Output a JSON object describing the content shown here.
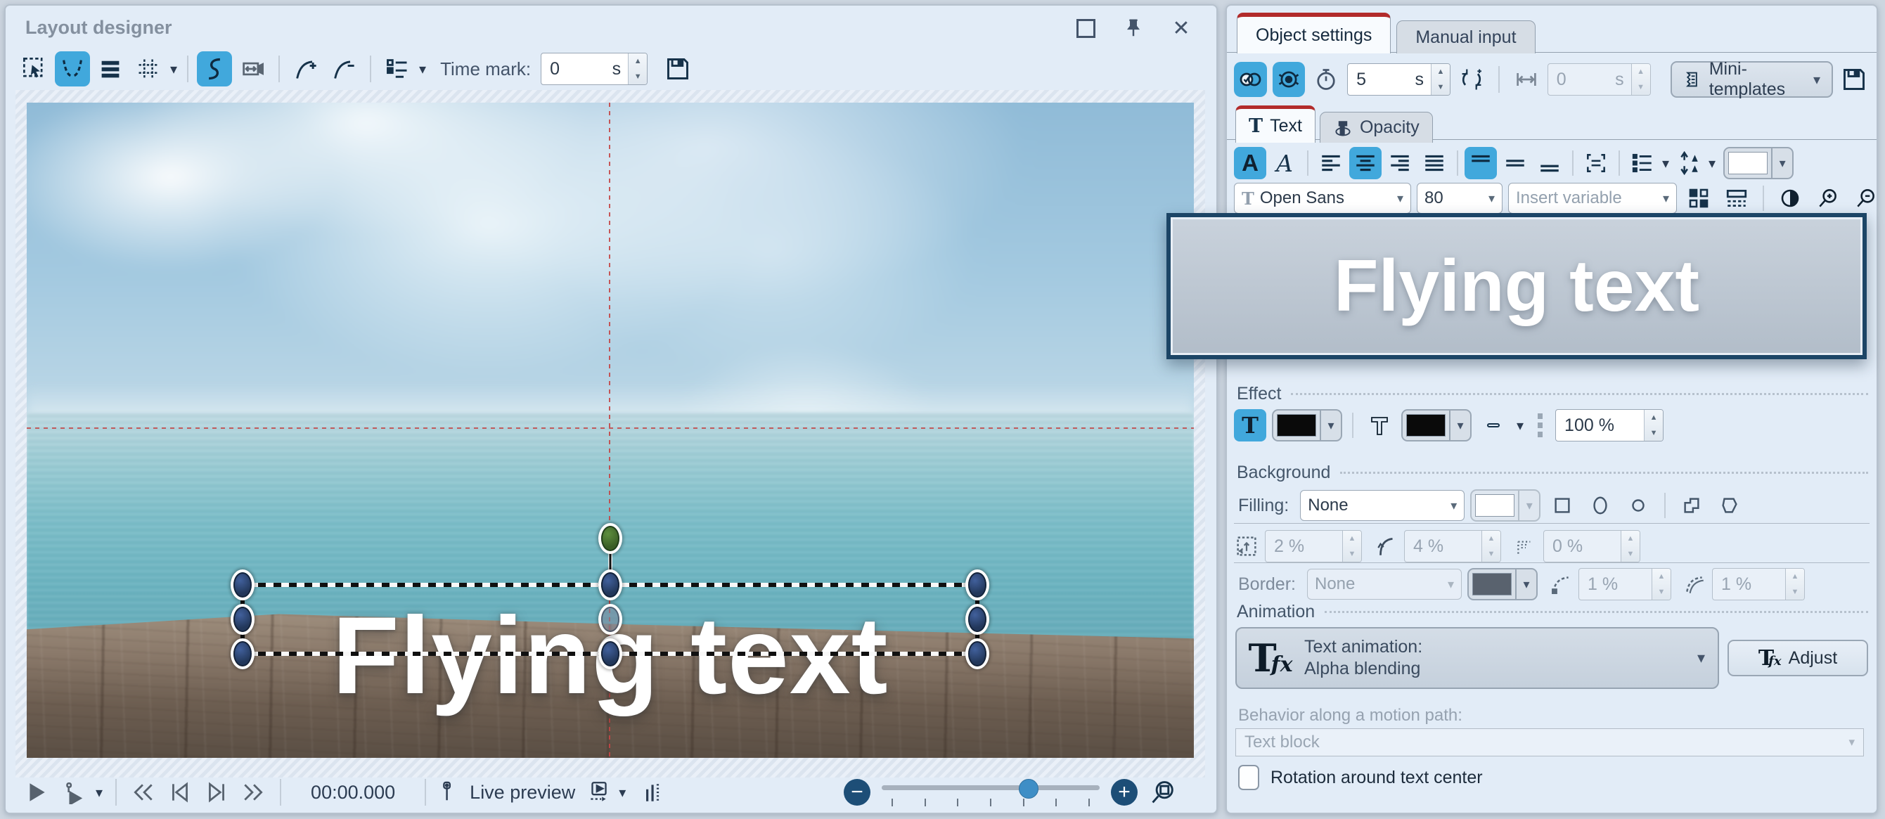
{
  "icons": {
    "dropdown": "▾",
    "spin_up": "▲",
    "spin_down": "▼",
    "close": "✕",
    "bold": "A",
    "italic": "A",
    "minus": "−",
    "plus": "+"
  },
  "colors": {
    "accent_blue": "#41a8dc",
    "tab_red": "#b22b2b",
    "navy": "#16324a",
    "handle_navy": "#2c4163",
    "handle_green": "#4c7a33",
    "guide_red": "#c24444"
  },
  "layout_designer": {
    "title": "Layout designer",
    "toolbar": {
      "time_mark_label": "Time mark:",
      "time_mark_value": "0",
      "time_mark_unit": "s"
    },
    "canvas": {
      "text": "Flying text"
    },
    "transport": {
      "time": "00:00.000",
      "live_preview_label": "Live preview"
    }
  },
  "object_panel": {
    "tabs": [
      {
        "label": "Object settings"
      },
      {
        "label": "Manual input"
      }
    ],
    "toolbar": {
      "duration_value": "5",
      "duration_unit": "s",
      "offset_value": "0",
      "offset_unit": "s",
      "mini_templates_label": "Mini-templates"
    },
    "subtabs": [
      {
        "label": "Text"
      },
      {
        "label": "Opacity"
      }
    ],
    "font": {
      "family": "Open Sans",
      "size": "80",
      "insert_variable_placeholder": "Insert variable"
    },
    "preview_text": "Flying text",
    "effect": {
      "header": "Effect",
      "opacity_value": "100 %"
    },
    "background": {
      "header": "Background",
      "filling_label": "Filling:",
      "filling_value": "None",
      "margin_value": "2 %",
      "corner_value": "4 %",
      "blur_value": "0 %",
      "border_label": "Border:",
      "border_value": "None",
      "border_width_value": "1 %",
      "border_corner_value": "1 %"
    },
    "animation": {
      "header": "Animation",
      "type_label": "Text animation:",
      "type_value": "Alpha blending",
      "adjust_label": "Adjust",
      "behavior_label": "Behavior along a motion path:",
      "behavior_value": "Text block",
      "rotation_checkbox_label": "Rotation around text center"
    }
  }
}
